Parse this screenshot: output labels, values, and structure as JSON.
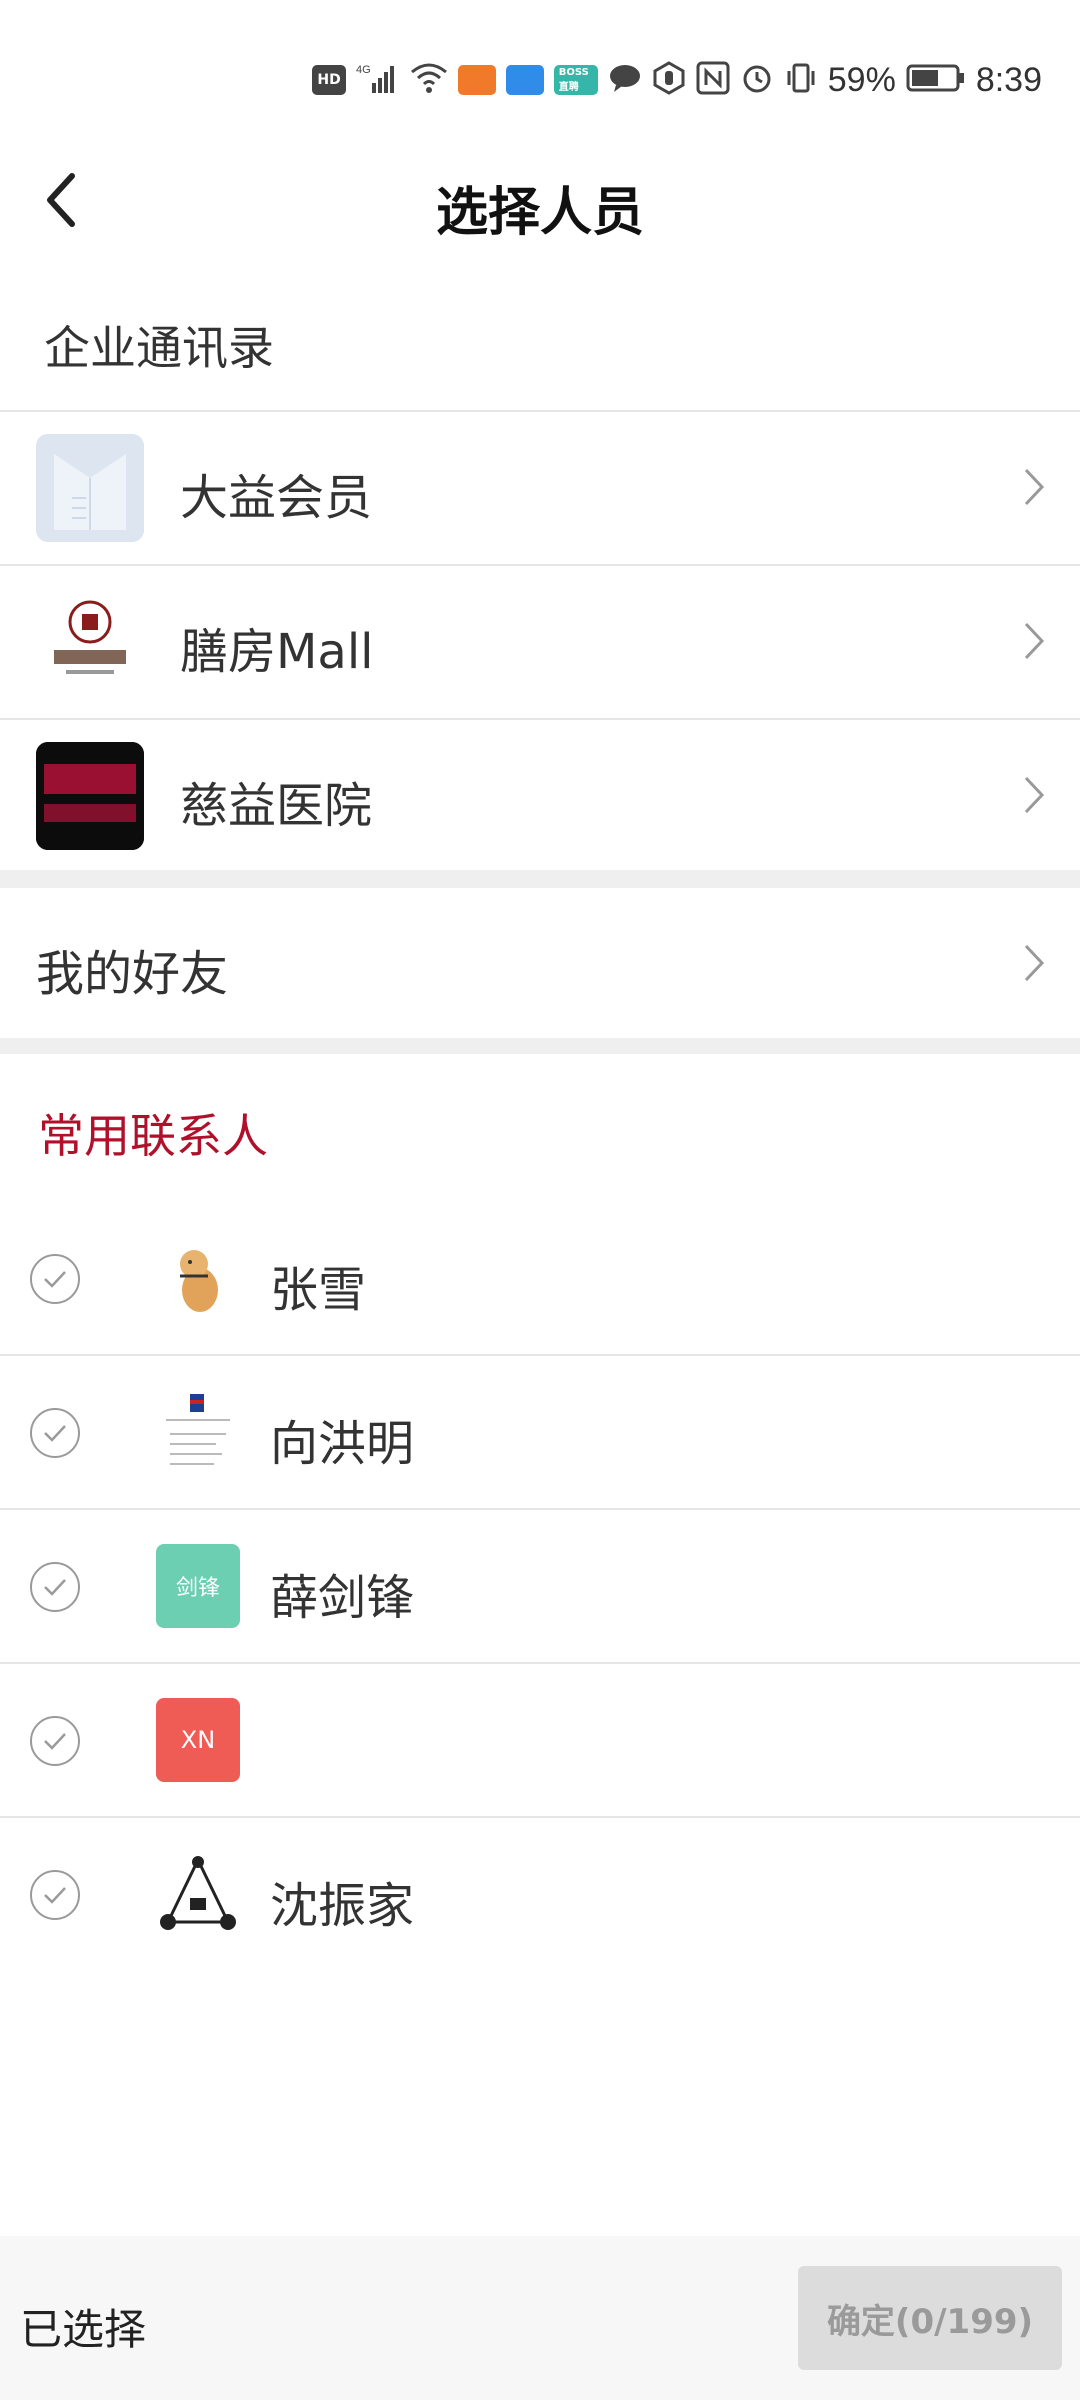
{
  "status_bar": {
    "hd": "HD",
    "network": "4G",
    "battery_percent": "59%",
    "time": "8:39",
    "icons": [
      "hd-icon",
      "signal-icon",
      "wifi-icon",
      "app-icon-orange",
      "app-icon-blue",
      "boss-zhipin-icon",
      "message-icon",
      "hand-icon",
      "nfc-icon",
      "alarm-icon",
      "vibrate-icon",
      "battery-icon"
    ],
    "boss_label": "BOSS 直聘"
  },
  "header": {
    "title": "选择人员",
    "back_icon": "chevron-left-icon"
  },
  "enterprise": {
    "label": "企业通讯录",
    "orgs": [
      {
        "name": "大益会员"
      },
      {
        "name": "膳房Mall"
      },
      {
        "name": "慈益医院"
      }
    ]
  },
  "friends": {
    "label": "我的好友"
  },
  "frequent": {
    "label": "常用联系人",
    "accent_color": "#b0102a",
    "contacts": [
      {
        "name": "张雪",
        "avatar_text": ""
      },
      {
        "name": "向洪明",
        "avatar_text": ""
      },
      {
        "name": "薛剑锋",
        "avatar_text": "剑锋",
        "avatar_color": "#6dcfb2"
      },
      {
        "name": "",
        "avatar_text": "XN",
        "avatar_color": "#ef5b55"
      },
      {
        "name": "沈振家",
        "avatar_text": ""
      }
    ]
  },
  "footer": {
    "selected_label": "已选择",
    "confirm_label": "确定(0/199)"
  }
}
